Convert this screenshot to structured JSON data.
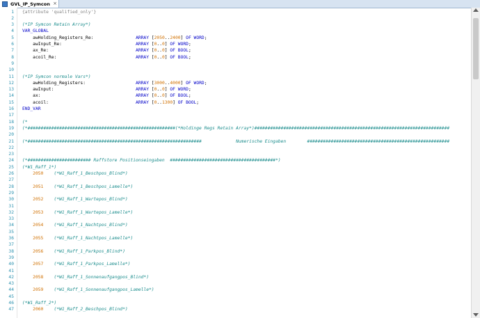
{
  "tab": {
    "title": "GVL_IP_Symcon",
    "close": "×"
  },
  "lines": [
    {
      "n": "1",
      "t": "{attribute 'qualified_only'}",
      "s": "attr"
    },
    {
      "n": "2",
      "t": "",
      "s": "id"
    },
    {
      "n": "3",
      "t": "(*IP Symcon Retain Array*)",
      "s": "comment"
    },
    {
      "n": "4",
      "t": "VAR_GLOBAL",
      "s": "kw"
    },
    {
      "n": "5",
      "t": "    awHolding_Registers_Re:                ARRAY [2050..2400] OF WORD;",
      "s": "decl"
    },
    {
      "n": "6",
      "t": "    awInput_Re:                            ARRAY [0..0] OF WORD;",
      "s": "decl"
    },
    {
      "n": "7",
      "t": "    ax_Re:                                 ARRAY [0..0] OF BOOL;",
      "s": "decl"
    },
    {
      "n": "8",
      "t": "    acoil_Re:                              ARRAY [0..0] OF BOOL;",
      "s": "decl"
    },
    {
      "n": "9",
      "t": "",
      "s": "id"
    },
    {
      "n": "10",
      "t": "",
      "s": "id"
    },
    {
      "n": "11",
      "t": "(*IP Symcon normale Vars*)",
      "s": "comment"
    },
    {
      "n": "12",
      "t": "    awHolding_Registers:                   ARRAY [3000..4000] OF WORD;",
      "s": "decl"
    },
    {
      "n": "13",
      "t": "    awInput:                               ARRAY [0..0] OF WORD;",
      "s": "decl"
    },
    {
      "n": "14",
      "t": "    ax:                                    ARRAY [0..0] OF BOOL;",
      "s": "decl"
    },
    {
      "n": "15",
      "t": "    acoil:                                 ARRAY [0..1300] OF BOOL;",
      "s": "decl"
    },
    {
      "n": "16",
      "t": "END_VAR",
      "s": "kw"
    },
    {
      "n": "17",
      "t": "",
      "s": "id"
    },
    {
      "n": "18",
      "t": "(*",
      "s": "comment"
    },
    {
      "n": "19",
      "t": "(*########################################################(*Holdinge Regs Retain Array*)##########################################################################",
      "s": "comment"
    },
    {
      "n": "20",
      "t": "",
      "s": "id"
    },
    {
      "n": "21",
      "t": "(*##################################################################             Numerische Eingaben        ######################################################",
      "s": "comment"
    },
    {
      "n": "22",
      "t": "",
      "s": "id"
    },
    {
      "n": "23",
      "t": "",
      "s": "id"
    },
    {
      "n": "24",
      "t": "(*######################## Raffstore Positionseingaben  ########################################*)",
      "s": "comment"
    },
    {
      "n": "25",
      "t": "(*W1_Raff_1*)",
      "s": "comment"
    },
    {
      "n": "26",
      "t": "    2050    (*W1_Raff_1_Beschpos_Blind*)",
      "s": "item"
    },
    {
      "n": "27",
      "t": "",
      "s": "id"
    },
    {
      "n": "28",
      "t": "    2051    (*W1_Raff_1_Beschpos_Lamelle*)",
      "s": "item"
    },
    {
      "n": "29",
      "t": "",
      "s": "id"
    },
    {
      "n": "30",
      "t": "    2052    (*W1_Raff_1_Wartepos_Blind*)",
      "s": "item"
    },
    {
      "n": "31",
      "t": "",
      "s": "id"
    },
    {
      "n": "32",
      "t": "    2053    (*W1_Raff_1_Wartepos_Lamelle*)",
      "s": "item"
    },
    {
      "n": "33",
      "t": "",
      "s": "id"
    },
    {
      "n": "34",
      "t": "    2054    (*W1_Raff_1_Nachtpos_Blind*)",
      "s": "item"
    },
    {
      "n": "35",
      "t": "",
      "s": "id"
    },
    {
      "n": "36",
      "t": "    2055    (*W1_Raff_1_Nachtpos_Lamelle*)",
      "s": "item"
    },
    {
      "n": "37",
      "t": "",
      "s": "id"
    },
    {
      "n": "38",
      "t": "    2056    (*W1_Raff_1_Parkpos_Blind*)",
      "s": "item"
    },
    {
      "n": "39",
      "t": "",
      "s": "id"
    },
    {
      "n": "40",
      "t": "    2057    (*W1_Raff_1_Parkpos_Lamelle*)",
      "s": "item"
    },
    {
      "n": "41",
      "t": "",
      "s": "id"
    },
    {
      "n": "42",
      "t": "    2058    (*W1_Raff_1_Sonnenaufgangpos_Blind*)",
      "s": "item"
    },
    {
      "n": "43",
      "t": "",
      "s": "id"
    },
    {
      "n": "44",
      "t": "    2059    (*W1_Raff_1_Sonnenaufgangpos_Lamelle*)",
      "s": "item"
    },
    {
      "n": "45",
      "t": "",
      "s": "id"
    },
    {
      "n": "46",
      "t": "(*W1_Raff_2*)",
      "s": "comment"
    },
    {
      "n": "47",
      "t": "    2060    (*W1_Raff_2_Beschpos_Blind*)",
      "s": "item"
    }
  ]
}
